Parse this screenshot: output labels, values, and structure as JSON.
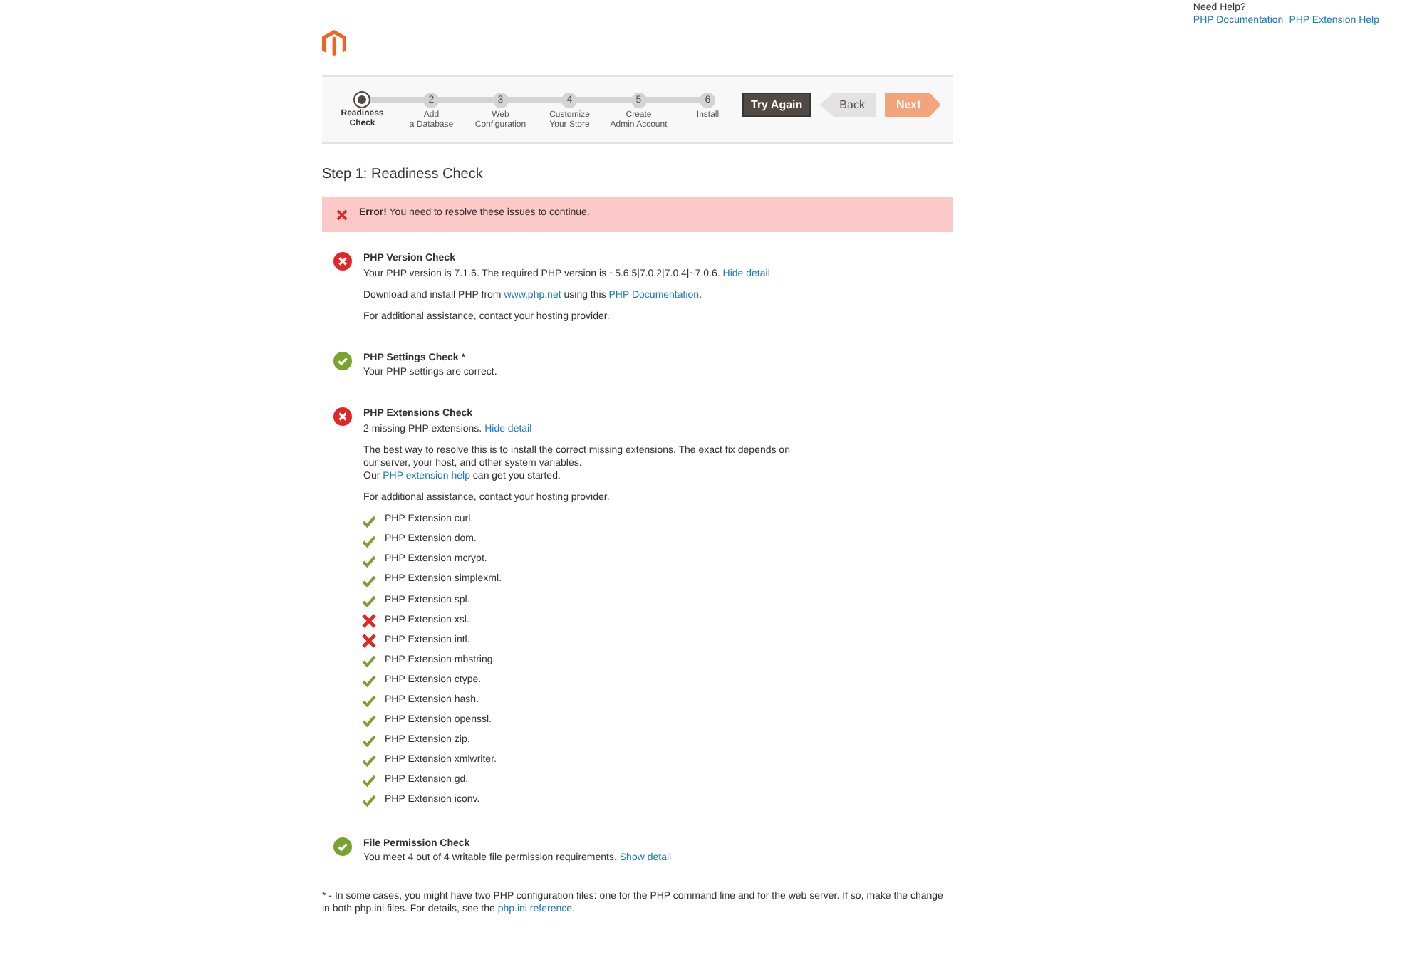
{
  "help": {
    "title": "Need Help?",
    "links": [
      "PHP Documentation",
      "PHP Extension Help"
    ]
  },
  "steps": [
    {
      "label": [
        "Readiness",
        "Check"
      ],
      "selected": true
    },
    {
      "number": "2",
      "label": [
        "Add",
        "a Database"
      ],
      "selected": false
    },
    {
      "number": "3",
      "label": [
        "Web",
        "Configuration"
      ],
      "selected": false
    },
    {
      "number": "4",
      "label": [
        "Customize",
        "Your Store"
      ],
      "selected": false
    },
    {
      "number": "5",
      "label": [
        "Create",
        "Admin Account"
      ],
      "selected": false
    },
    {
      "number": "6",
      "label": [
        "Install"
      ],
      "selected": false
    }
  ],
  "buttons": {
    "try_again": "Try Again",
    "back": "Back",
    "next": "Next"
  },
  "step_title": "Step 1: Readiness Check",
  "error": {
    "bold": "Error!",
    "text": "You need to resolve these issues to continue."
  },
  "checks": [
    {
      "title": "PHP Version Check",
      "passed": false,
      "summary": [
        {
          "text": "Your PHP version is 7.1.6. The required PHP version is ~5.6.5|7.0.2|7.0.4|~7.0.6. "
        },
        {
          "link": "Hide detail"
        }
      ],
      "details": [
        [
          [
            {
              "text": "Download and install PHP from "
            },
            {
              "link": "www.php.net"
            },
            {
              "text": " using this "
            },
            {
              "link": "PHP Documentation"
            },
            {
              "text": "."
            }
          ]
        ],
        [
          [
            {
              "text": "For additional assistance, contact your hosting provider."
            }
          ]
        ]
      ]
    },
    {
      "title": "PHP Settings Check *",
      "passed": true,
      "summary": [
        {
          "text": "Your PHP settings are correct."
        }
      ]
    },
    {
      "title": "PHP Extensions Check",
      "passed": false,
      "summary": [
        {
          "text": "2 missing PHP extensions. "
        },
        {
          "link": "Hide detail"
        }
      ],
      "details": [
        [
          [
            {
              "text": "The best way to resolve this is to install the correct missing extensions. The exact fix depends on our server, your host, and other system variables."
            }
          ],
          [
            {
              "text": "Our "
            },
            {
              "link": "PHP extension help"
            },
            {
              "text": " can get you started."
            }
          ]
        ],
        [
          [
            {
              "text": "For additional assistance, contact your hosting provider."
            }
          ]
        ]
      ],
      "extensions": [
        {
          "name": "PHP Extension curl.",
          "installed": true
        },
        {
          "name": "PHP Extension dom.",
          "installed": true
        },
        {
          "name": "PHP Extension mcrypt.",
          "installed": true
        },
        {
          "name": "PHP Extension simplexml.",
          "installed": true
        },
        {
          "name": "PHP Extension spl.",
          "installed": true
        },
        {
          "name": "PHP Extension xsl.",
          "installed": false
        },
        {
          "name": "PHP Extension intl.",
          "installed": false
        },
        {
          "name": "PHP Extension mbstring.",
          "installed": true
        },
        {
          "name": "PHP Extension ctype.",
          "installed": true
        },
        {
          "name": "PHP Extension hash.",
          "installed": true
        },
        {
          "name": "PHP Extension openssl.",
          "installed": true
        },
        {
          "name": "PHP Extension zip.",
          "installed": true
        },
        {
          "name": "PHP Extension xmlwriter.",
          "installed": true
        },
        {
          "name": "PHP Extension gd.",
          "installed": true
        },
        {
          "name": "PHP Extension iconv.",
          "installed": true
        }
      ]
    },
    {
      "title": "File Permission Check",
      "passed": true,
      "summary": [
        {
          "text": "You meet 4 out of 4 writable file permission requirements. "
        },
        {
          "link": "Show detail"
        }
      ]
    }
  ],
  "footnote": [
    {
      "text": "* - In some cases, you might have two PHP configuration files: one for the PHP command line and for the web server. If so, make the change in both php.ini files. For details, see the "
    },
    {
      "link": "php.ini reference"
    },
    {
      "text": "."
    }
  ]
}
